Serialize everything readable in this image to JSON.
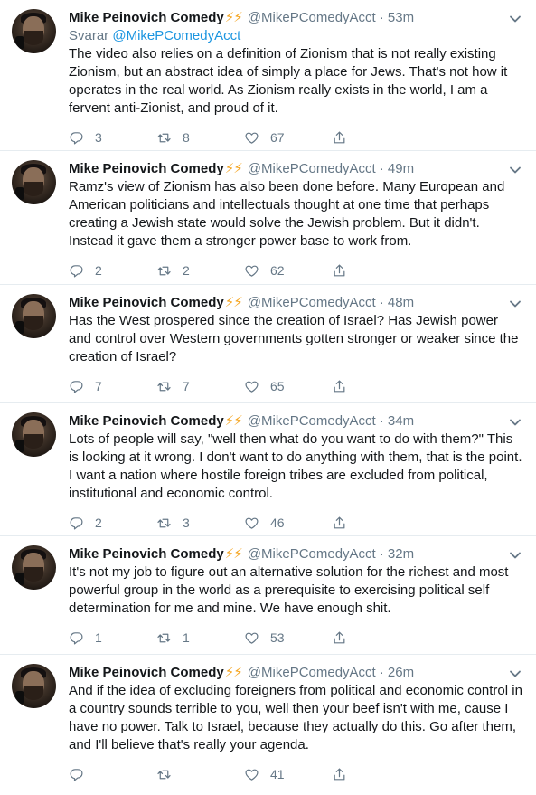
{
  "tweets": [
    {
      "name": "Mike Peinovich Comedy",
      "bolts": "⚡⚡",
      "handle": "@MikePComedyAcct",
      "time": "· 53m",
      "replying_prefix": "Svarar",
      "replying_to": "@MikePComedyAcct",
      "text": "The video also relies on a definition of Zionism that is not really existing Zionism, but an abstract idea of simply a place for Jews. That's not how it operates in the real world. As Zionism really exists in the world, I am a fervent anti-Zionist, and proud of it.",
      "replies": "3",
      "retweets": "8",
      "likes": "67"
    },
    {
      "name": "Mike Peinovich Comedy",
      "bolts": "⚡⚡",
      "handle": "@MikePComedyAcct",
      "time": "· 49m",
      "text": "Ramz's view of Zionism has also been done before. Many European and American politicians and intellectuals thought at one time that perhaps creating a Jewish state would solve the Jewish problem. But it didn't. Instead it gave them a stronger power base to work from.",
      "replies": "2",
      "retweets": "2",
      "likes": "62"
    },
    {
      "name": "Mike Peinovich Comedy",
      "bolts": "⚡⚡",
      "handle": "@MikePComedyAcct",
      "time": "· 48m",
      "text": "Has the West prospered since the creation of Israel? Has Jewish power and control over Western governments gotten stronger or weaker since the creation of Israel?",
      "replies": "7",
      "retweets": "7",
      "likes": "65"
    },
    {
      "name": "Mike Peinovich Comedy",
      "bolts": "⚡⚡",
      "handle": "@MikePComedyAcct",
      "time": "· 34m",
      "text": "Lots of people will say, \"well then what do you want to do with them?\" This is looking at it wrong. I don't want to do anything with them, that is the point. I want a nation where hostile foreign tribes are excluded from political, institutional and economic control.",
      "replies": "2",
      "retweets": "3",
      "likes": "46"
    },
    {
      "name": "Mike Peinovich Comedy",
      "bolts": "⚡⚡",
      "handle": "@MikePComedyAcct",
      "time": "· 32m",
      "text": "It's not my job to figure out an alternative solution for the richest and most powerful group in the world as a prerequisite to exercising political self determination for me and mine. We have enough shit.",
      "replies": "1",
      "retweets": "1",
      "likes": "53"
    },
    {
      "name": "Mike Peinovich Comedy",
      "bolts": "⚡⚡",
      "handle": "@MikePComedyAcct",
      "time": "· 26m",
      "text": "And if the idea of excluding foreigners from political and economic control in a country sounds terrible to you, well then your beef isn't with me, cause I have no power. Talk to Israel, because they actually do this. Go after them, and I'll believe that's really your agenda.",
      "replies": "",
      "retweets": "",
      "likes": "41"
    }
  ],
  "icons": {
    "reply": "reply-icon",
    "retweet": "retweet-icon",
    "like": "heart-icon",
    "share": "share-icon",
    "menu": "chevron-down-icon"
  },
  "colors": {
    "text": "#14171a",
    "secondary": "#657786",
    "link": "#1b95e0",
    "bolt": "#f5a623",
    "divider": "#e6ecf0"
  }
}
